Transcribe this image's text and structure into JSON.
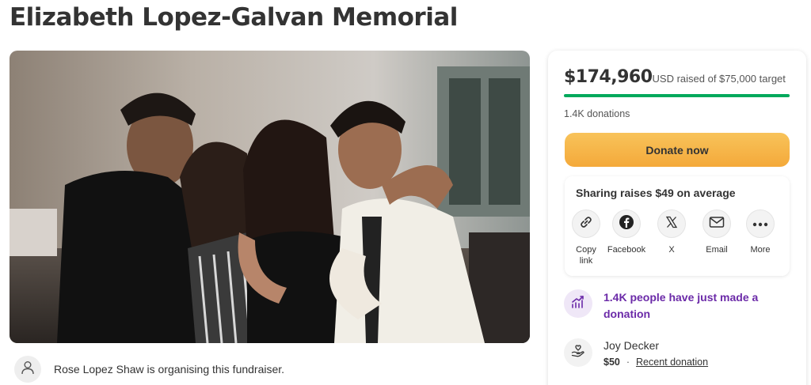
{
  "page": {
    "title": "Elizabeth Lopez-Galvan Memorial"
  },
  "organiser": {
    "text": "Rose Lopez Shaw is organising this fundraiser."
  },
  "donation": {
    "amount_raised": "$174,960",
    "raised_suffix": "USD raised of $75,000 target",
    "progress_fraction": 1.0,
    "progress_color": "#02a95c",
    "donation_count": "1.4K donations",
    "donate_button": "Donate now",
    "donate_button_color": "#f6b64a"
  },
  "share": {
    "title": "Sharing raises $49 on average",
    "items": [
      {
        "icon": "link-icon",
        "label": "Copy link"
      },
      {
        "icon": "facebook-icon",
        "label": "Facebook"
      },
      {
        "icon": "x-icon",
        "label": "X"
      },
      {
        "icon": "email-icon",
        "label": "Email"
      },
      {
        "icon": "more-icon",
        "label": "More"
      }
    ]
  },
  "activity": {
    "trend_text": "1.4K people have just made a donation",
    "trend_color": "#6b2aa8",
    "donor_name": "Joy Decker",
    "donor_amount": "$50",
    "donor_link": "Recent donation"
  }
}
